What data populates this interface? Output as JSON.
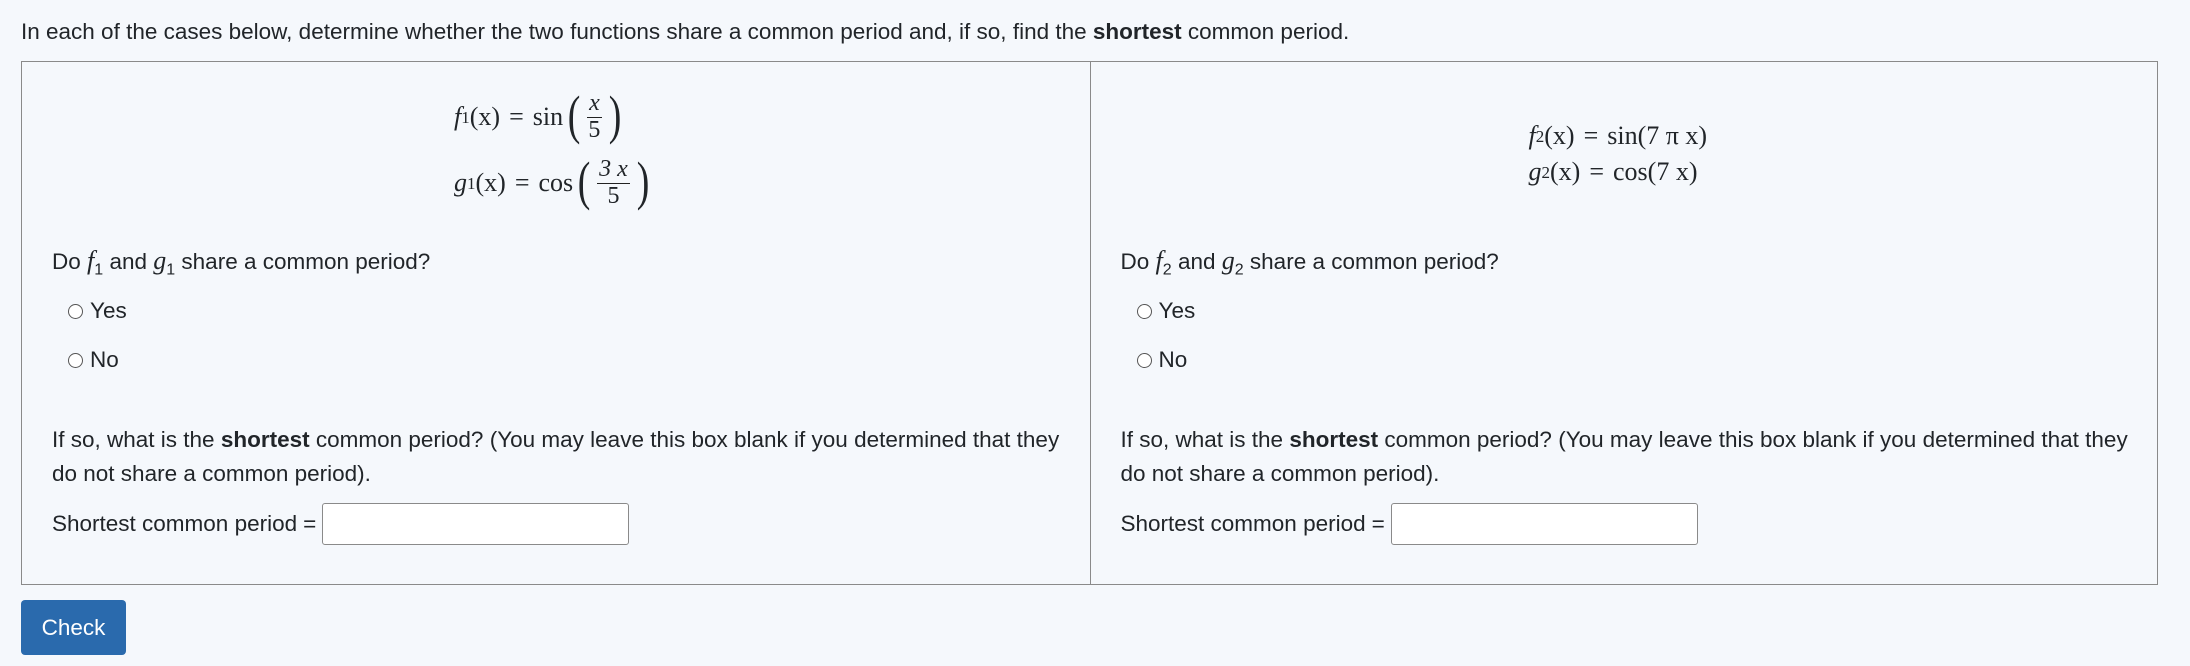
{
  "intro": {
    "before": "In each of the cases below, determine whether the two functions share a common period and, if so, find the ",
    "bold": "shortest",
    "after": " common period."
  },
  "case1": {
    "f_name": "f",
    "f_sub": "1",
    "g_name": "g",
    "g_sub": "1",
    "var": "(x)",
    "equals": "=",
    "f_func": "sin",
    "f_num": "x",
    "f_den": "5",
    "g_func": "cos",
    "g_num": "3 x",
    "g_den": "5",
    "question_do": "Do",
    "question_and": "and",
    "question_rest": "share a common period?",
    "options": [
      "Yes",
      "No"
    ],
    "para_before": "If so, what is the ",
    "para_bold": "shortest",
    "para_after": " common period? (You may leave this box blank if you determined that they do not share a common period).",
    "answer_label": "Shortest common period",
    "answer_eq": "=",
    "answer_value": ""
  },
  "case2": {
    "f_name": "f",
    "f_sub": "2",
    "g_name": "g",
    "g_sub": "2",
    "var": "(x)",
    "equals": "=",
    "f_rhs": "sin(7 π x)",
    "g_rhs": "cos(7 x)",
    "question_do": "Do",
    "question_and": "and",
    "question_rest": "share a common period?",
    "options": [
      "Yes",
      "No"
    ],
    "para_before": "If so, what is the ",
    "para_bold": "shortest",
    "para_after": " common period? (You may leave this box blank if you determined that they do not share a common period).",
    "answer_label": "Shortest common period",
    "answer_eq": "=",
    "answer_value": ""
  },
  "check_label": "Check"
}
